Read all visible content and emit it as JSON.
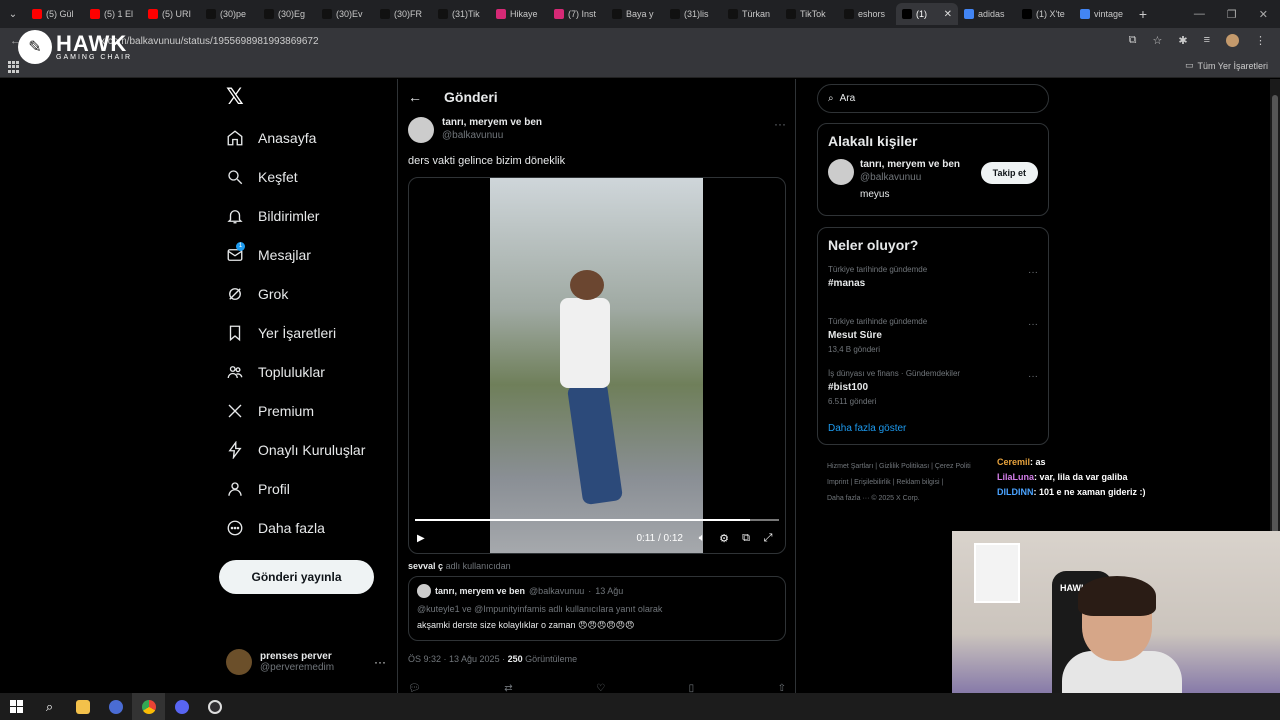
{
  "browser": {
    "tabs": [
      {
        "label": "(5) Gül",
        "icon": "youtube-icon",
        "color": "#ff0000"
      },
      {
        "label": "(5) 1 El",
        "icon": "youtube-icon",
        "color": "#ff0000"
      },
      {
        "label": "(5) URI",
        "icon": "youtube-icon",
        "color": "#ff0000"
      },
      {
        "label": "(30)pe",
        "icon": "tiktok-icon",
        "color": "#111111"
      },
      {
        "label": "(30)Eg",
        "icon": "tiktok-icon",
        "color": "#111111"
      },
      {
        "label": "(30)Ev",
        "icon": "tiktok-icon",
        "color": "#111111"
      },
      {
        "label": "(30)FR",
        "icon": "tiktok-icon",
        "color": "#111111"
      },
      {
        "label": "(31)Tik",
        "icon": "tiktok-icon",
        "color": "#111111"
      },
      {
        "label": "Hikaye",
        "icon": "instagram-icon",
        "color": "#d62976"
      },
      {
        "label": "(7) Inst",
        "icon": "instagram-icon",
        "color": "#d62976"
      },
      {
        "label": "Baya y",
        "icon": "tiktok-icon",
        "color": "#111111"
      },
      {
        "label": "(31)lis",
        "icon": "tiktok-icon",
        "color": "#111111"
      },
      {
        "label": "Türkan",
        "icon": "tiktok-icon",
        "color": "#111111"
      },
      {
        "label": "TikTok",
        "icon": "tiktok-icon",
        "color": "#111111"
      },
      {
        "label": "eshors",
        "icon": "tiktok-icon",
        "color": "#111111"
      },
      {
        "label": "(1)",
        "icon": "x-icon",
        "color": "#000000",
        "active": true
      },
      {
        "label": "adidas",
        "icon": "google-icon",
        "color": "#4285f4"
      },
      {
        "label": "(1) X'te",
        "icon": "x-icon",
        "color": "#000000"
      },
      {
        "label": "vintage",
        "icon": "google-icon",
        "color": "#4285f4"
      }
    ],
    "url": "x.com/balkavunuu/status/1955698981993869672",
    "bookmarks_folder": "Tüm Yer İşaretleri"
  },
  "overlay_logo": {
    "brand": "HAWK",
    "tagline": "GAMING CHAIR"
  },
  "nav": {
    "items": [
      {
        "label": "Anasayfa",
        "icon": "home-icon"
      },
      {
        "label": "Keşfet",
        "icon": "search-icon"
      },
      {
        "label": "Bildirimler",
        "icon": "bell-icon"
      },
      {
        "label": "Mesajlar",
        "icon": "mail-icon",
        "badge": "1"
      },
      {
        "label": "Grok",
        "icon": "grok-icon"
      },
      {
        "label": "Yer İşaretleri",
        "icon": "bookmark-icon"
      },
      {
        "label": "Topluluklar",
        "icon": "people-icon"
      },
      {
        "label": "Premium",
        "icon": "x-premium-icon"
      },
      {
        "label": "Onaylı Kuruluşlar",
        "icon": "lightning-icon"
      },
      {
        "label": "Profil",
        "icon": "person-icon"
      },
      {
        "label": "Daha fazla",
        "icon": "more-circle-icon"
      }
    ],
    "post_button": "Gönderi yayınla",
    "account": {
      "name": "prenses perver",
      "handle": "@perveremedim"
    }
  },
  "main": {
    "header": "Gönderi",
    "tweet": {
      "author": "tanrı, meryem ve ben",
      "handle": "@balkavunuu",
      "text": "ders vakti gelince bizim döneklik",
      "video_time": "0:11 / 0:12",
      "video_progress": 0.92,
      "quoted_by_prefix": "sevval ç",
      "quoted_by_suffix": "adlı kullanıcıdan",
      "quote": {
        "author": "tanrı, meryem ve ben",
        "handle": "@balkavunuu",
        "date": "13 Ağu",
        "reply_to": "@kuteyle1 ve @Impunityinfamis adlı kullanıcılara yanıt olarak",
        "text": "akşamki derste size kolaylıklar o zaman 😠😠😠😠😠😠"
      },
      "timestamp": "ÖS 9:32 · 13 Ağu 2025 ·",
      "views_count": "250",
      "views_label": "Görüntüleme"
    }
  },
  "right": {
    "search_placeholder": "Ara",
    "related": {
      "title": "Alakalı kişiler",
      "name": "tanrı, meryem ve ben",
      "handle": "@balkavunuu",
      "bio": "meyus",
      "follow": "Takip et"
    },
    "trends": {
      "title": "Neler oluyor?",
      "items": [
        {
          "context": "Türkiye tarihinde gündemde",
          "name": "#manas",
          "count": ""
        },
        {
          "context": "Türkiye tarihinde gündemde",
          "name": "Mesut Süre",
          "count": "13,4 B gönderi"
        },
        {
          "context": "İş dünyası ve finans · Gündemdekiler",
          "name": "#bist100",
          "count": "6.511 gönderi"
        }
      ],
      "show_more": "Daha fazla göster"
    },
    "footer": {
      "line1": "Hizmet Şartları  |  Gizlilik Politikası  |  Çerez Politi",
      "line2": "Imprint  |  Erişilebilirlik  |  Reklam bilgisi  |",
      "line3": "Daha fazla ···   © 2025 X Corp."
    }
  },
  "chat": [
    {
      "user": "Ceremil",
      "text": ": as"
    },
    {
      "user": "LilaLuna",
      "text": ": var, lila da var galiba"
    },
    {
      "user": "DILDINN",
      "text": ": 101 e ne xaman gideriz :)"
    }
  ],
  "webcam": {
    "chair_label": "HAWK"
  }
}
